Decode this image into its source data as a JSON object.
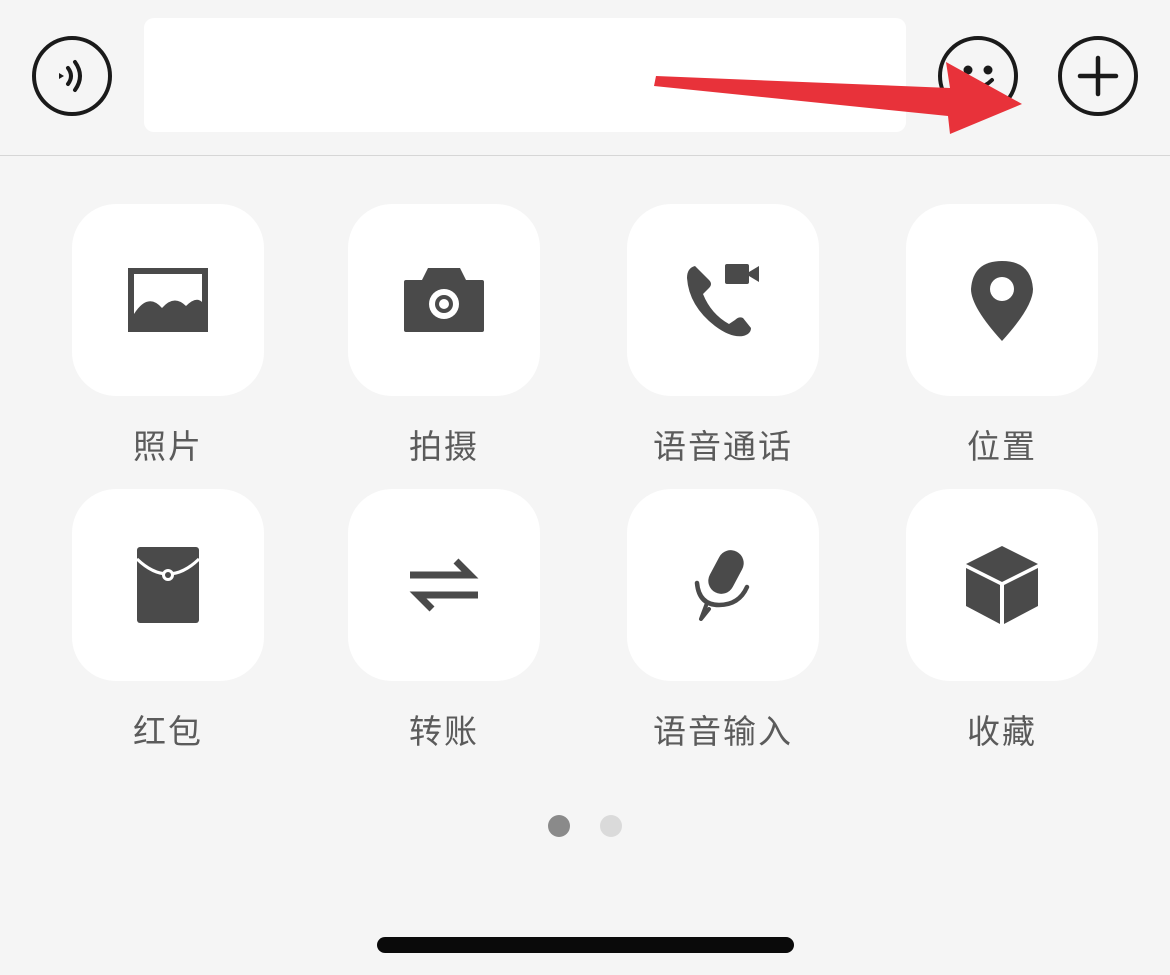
{
  "input_bar": {
    "message_value": "",
    "message_placeholder": ""
  },
  "actions": [
    {
      "label": "照片",
      "icon": "image-icon"
    },
    {
      "label": "拍摄",
      "icon": "camera-icon"
    },
    {
      "label": "语音通话",
      "icon": "phone-video-call-icon"
    },
    {
      "label": "位置",
      "icon": "location-pin-icon"
    },
    {
      "label": "红包",
      "icon": "red-packet-icon"
    },
    {
      "label": "转账",
      "icon": "transfer-arrows-icon"
    },
    {
      "label": "语音输入",
      "icon": "microphone-icon"
    },
    {
      "label": "收藏",
      "icon": "cube-favorites-icon"
    }
  ],
  "pagination": {
    "current_page": 1,
    "total_pages": 2
  },
  "colors": {
    "background": "#f5f5f5",
    "tile": "#ffffff",
    "icon": "#4a4a4a",
    "label": "#5b5b5b",
    "annotation_arrow": "#e8323a",
    "active_dot": "#8a8a8a",
    "inactive_dot": "#dadada"
  }
}
